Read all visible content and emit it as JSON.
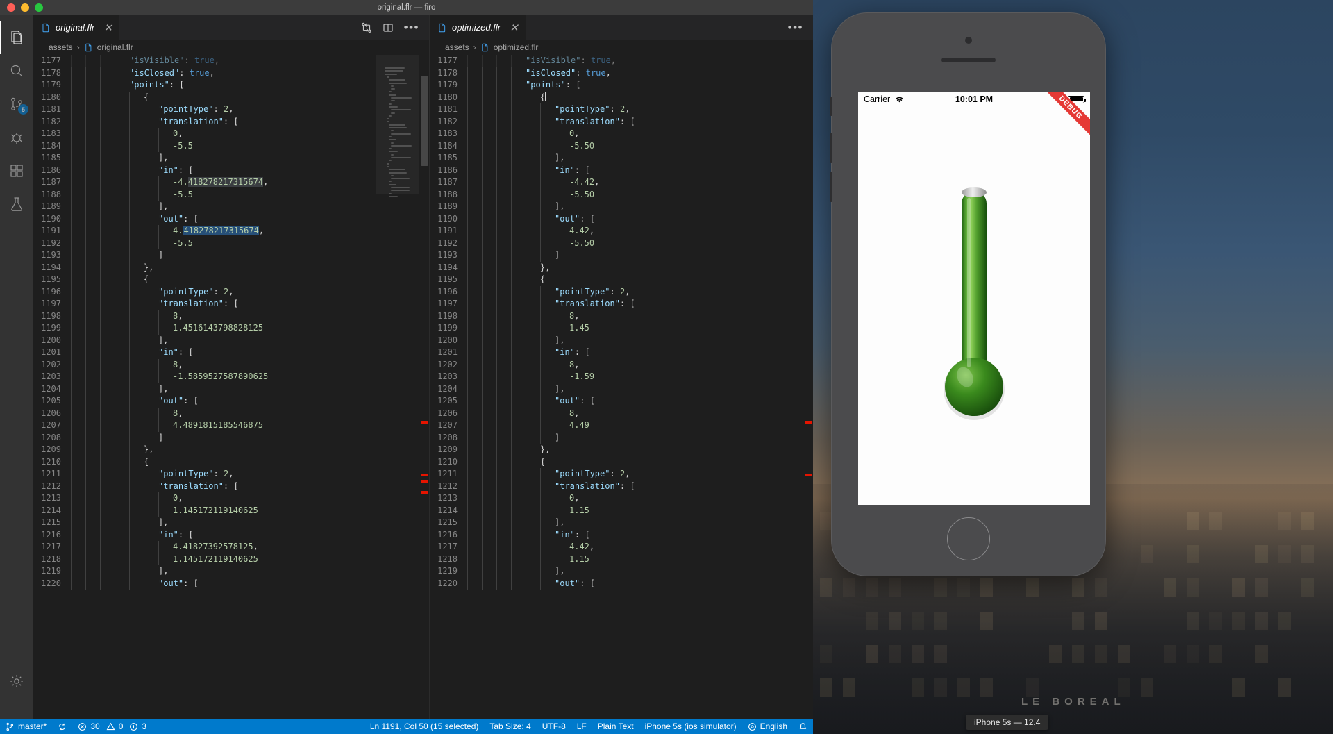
{
  "window": {
    "title": "original.flr — firo"
  },
  "activitybar": {
    "items": [
      {
        "name": "explorer",
        "icon": "files-icon"
      },
      {
        "name": "search",
        "icon": "search-icon"
      },
      {
        "name": "source-control",
        "icon": "source-control-icon",
        "badge": "5"
      },
      {
        "name": "debug",
        "icon": "debug-icon"
      },
      {
        "name": "extensions",
        "icon": "extensions-icon"
      },
      {
        "name": "testing",
        "icon": "beaker-icon"
      },
      {
        "name": "settings",
        "icon": "gear-icon"
      }
    ]
  },
  "editors": [
    {
      "tab_label": "original.flr",
      "breadcrumb": [
        "assets",
        "original.flr"
      ],
      "first_line": 1177,
      "lines": [
        {
          "n": 1177,
          "indent": 4,
          "text": "\"isVisible\": true,",
          "cut": true
        },
        {
          "n": 1178,
          "indent": 4,
          "text": "\"isClosed\": true,"
        },
        {
          "n": 1179,
          "indent": 4,
          "text": "\"points\": ["
        },
        {
          "n": 1180,
          "indent": 5,
          "text": "{"
        },
        {
          "n": 1181,
          "indent": 6,
          "text": "\"pointType\": 2,"
        },
        {
          "n": 1182,
          "indent": 6,
          "text": "\"translation\": ["
        },
        {
          "n": 1183,
          "indent": 7,
          "text": "0,"
        },
        {
          "n": 1184,
          "indent": 7,
          "text": "-5.5"
        },
        {
          "n": 1185,
          "indent": 6,
          "text": "],"
        },
        {
          "n": 1186,
          "indent": 6,
          "text": "\"in\": ["
        },
        {
          "n": 1187,
          "indent": 7,
          "text": "-4.418278217315674,",
          "sel": "418278217315674",
          "selstyle": "gray"
        },
        {
          "n": 1188,
          "indent": 7,
          "text": "-5.5"
        },
        {
          "n": 1189,
          "indent": 6,
          "text": "],"
        },
        {
          "n": 1190,
          "indent": 6,
          "text": "\"out\": ["
        },
        {
          "n": 1191,
          "indent": 7,
          "text": "4.418278217315674,",
          "sel": "418278217315674",
          "selstyle": "blue",
          "caret": true
        },
        {
          "n": 1192,
          "indent": 7,
          "text": "-5.5"
        },
        {
          "n": 1193,
          "indent": 6,
          "text": "]"
        },
        {
          "n": 1194,
          "indent": 5,
          "text": "},"
        },
        {
          "n": 1195,
          "indent": 5,
          "text": "{"
        },
        {
          "n": 1196,
          "indent": 6,
          "text": "\"pointType\": 2,"
        },
        {
          "n": 1197,
          "indent": 6,
          "text": "\"translation\": ["
        },
        {
          "n": 1198,
          "indent": 7,
          "text": "8,"
        },
        {
          "n": 1199,
          "indent": 7,
          "text": "1.4516143798828125"
        },
        {
          "n": 1200,
          "indent": 6,
          "text": "],"
        },
        {
          "n": 1201,
          "indent": 6,
          "text": "\"in\": ["
        },
        {
          "n": 1202,
          "indent": 7,
          "text": "8,"
        },
        {
          "n": 1203,
          "indent": 7,
          "text": "-1.5859527587890625"
        },
        {
          "n": 1204,
          "indent": 6,
          "text": "],"
        },
        {
          "n": 1205,
          "indent": 6,
          "text": "\"out\": ["
        },
        {
          "n": 1206,
          "indent": 7,
          "text": "8,"
        },
        {
          "n": 1207,
          "indent": 7,
          "text": "4.4891815185546875"
        },
        {
          "n": 1208,
          "indent": 6,
          "text": "]"
        },
        {
          "n": 1209,
          "indent": 5,
          "text": "},"
        },
        {
          "n": 1210,
          "indent": 5,
          "text": "{"
        },
        {
          "n": 1211,
          "indent": 6,
          "text": "\"pointType\": 2,"
        },
        {
          "n": 1212,
          "indent": 6,
          "text": "\"translation\": ["
        },
        {
          "n": 1213,
          "indent": 7,
          "text": "0,"
        },
        {
          "n": 1214,
          "indent": 7,
          "text": "1.145172119140625"
        },
        {
          "n": 1215,
          "indent": 6,
          "text": "],"
        },
        {
          "n": 1216,
          "indent": 6,
          "text": "\"in\": ["
        },
        {
          "n": 1217,
          "indent": 7,
          "text": "4.41827392578125,"
        },
        {
          "n": 1218,
          "indent": 7,
          "text": "1.145172119140625"
        },
        {
          "n": 1219,
          "indent": 6,
          "text": "],"
        },
        {
          "n": 1220,
          "indent": 6,
          "text": "\"out\": ["
        }
      ]
    },
    {
      "tab_label": "optimized.flr",
      "breadcrumb": [
        "assets",
        "optimized.flr"
      ],
      "first_line": 1177,
      "lines": [
        {
          "n": 1177,
          "indent": 4,
          "text": "\"isVisible\": true,",
          "cut": true
        },
        {
          "n": 1178,
          "indent": 4,
          "text": "\"isClosed\": true,"
        },
        {
          "n": 1179,
          "indent": 4,
          "text": "\"points\": ["
        },
        {
          "n": 1180,
          "indent": 5,
          "text": "{",
          "caret": true
        },
        {
          "n": 1181,
          "indent": 6,
          "text": "\"pointType\": 2,"
        },
        {
          "n": 1182,
          "indent": 6,
          "text": "\"translation\": ["
        },
        {
          "n": 1183,
          "indent": 7,
          "text": "0,"
        },
        {
          "n": 1184,
          "indent": 7,
          "text": "-5.50"
        },
        {
          "n": 1185,
          "indent": 6,
          "text": "],"
        },
        {
          "n": 1186,
          "indent": 6,
          "text": "\"in\": ["
        },
        {
          "n": 1187,
          "indent": 7,
          "text": "-4.42,"
        },
        {
          "n": 1188,
          "indent": 7,
          "text": "-5.50"
        },
        {
          "n": 1189,
          "indent": 6,
          "text": "],"
        },
        {
          "n": 1190,
          "indent": 6,
          "text": "\"out\": ["
        },
        {
          "n": 1191,
          "indent": 7,
          "text": "4.42,"
        },
        {
          "n": 1192,
          "indent": 7,
          "text": "-5.50"
        },
        {
          "n": 1193,
          "indent": 6,
          "text": "]"
        },
        {
          "n": 1194,
          "indent": 5,
          "text": "},"
        },
        {
          "n": 1195,
          "indent": 5,
          "text": "{"
        },
        {
          "n": 1196,
          "indent": 6,
          "text": "\"pointType\": 2,"
        },
        {
          "n": 1197,
          "indent": 6,
          "text": "\"translation\": ["
        },
        {
          "n": 1198,
          "indent": 7,
          "text": "8,"
        },
        {
          "n": 1199,
          "indent": 7,
          "text": "1.45"
        },
        {
          "n": 1200,
          "indent": 6,
          "text": "],"
        },
        {
          "n": 1201,
          "indent": 6,
          "text": "\"in\": ["
        },
        {
          "n": 1202,
          "indent": 7,
          "text": "8,"
        },
        {
          "n": 1203,
          "indent": 7,
          "text": "-1.59"
        },
        {
          "n": 1204,
          "indent": 6,
          "text": "],"
        },
        {
          "n": 1205,
          "indent": 6,
          "text": "\"out\": ["
        },
        {
          "n": 1206,
          "indent": 7,
          "text": "8,"
        },
        {
          "n": 1207,
          "indent": 7,
          "text": "4.49"
        },
        {
          "n": 1208,
          "indent": 6,
          "text": "]"
        },
        {
          "n": 1209,
          "indent": 5,
          "text": "},"
        },
        {
          "n": 1210,
          "indent": 5,
          "text": "{"
        },
        {
          "n": 1211,
          "indent": 6,
          "text": "\"pointType\": 2,"
        },
        {
          "n": 1212,
          "indent": 6,
          "text": "\"translation\": ["
        },
        {
          "n": 1213,
          "indent": 7,
          "text": "0,"
        },
        {
          "n": 1214,
          "indent": 7,
          "text": "1.15"
        },
        {
          "n": 1215,
          "indent": 6,
          "text": "],"
        },
        {
          "n": 1216,
          "indent": 6,
          "text": "\"in\": ["
        },
        {
          "n": 1217,
          "indent": 7,
          "text": "4.42,"
        },
        {
          "n": 1218,
          "indent": 7,
          "text": "1.15"
        },
        {
          "n": 1219,
          "indent": 6,
          "text": "],"
        },
        {
          "n": 1220,
          "indent": 6,
          "text": "\"out\": ["
        }
      ]
    }
  ],
  "statusbar": {
    "branch": "master*",
    "sync_icon": "sync-icon",
    "errors": "30",
    "warnings": "0",
    "infos": "3",
    "cursor": "Ln 1191, Col 50 (15 selected)",
    "tabsize": "Tab Size: 4",
    "encoding": "UTF-8",
    "eol": "LF",
    "language": "Plain Text",
    "device": "iPhone 5s (ios simulator)",
    "spellcheck": "English",
    "bell_icon": "bell-icon",
    "accent": "#007acc"
  },
  "simulator": {
    "carrier": "Carrier",
    "time": "10:01 PM",
    "debug_banner": "DEBUG",
    "device_label": "iPhone 5s — 12.4",
    "thermometer": {
      "fill_color": "#2e7d1e",
      "bulb_color": "#1f6b12",
      "level_percent": 100
    },
    "wallpaper_text": "LE BOREAL"
  }
}
